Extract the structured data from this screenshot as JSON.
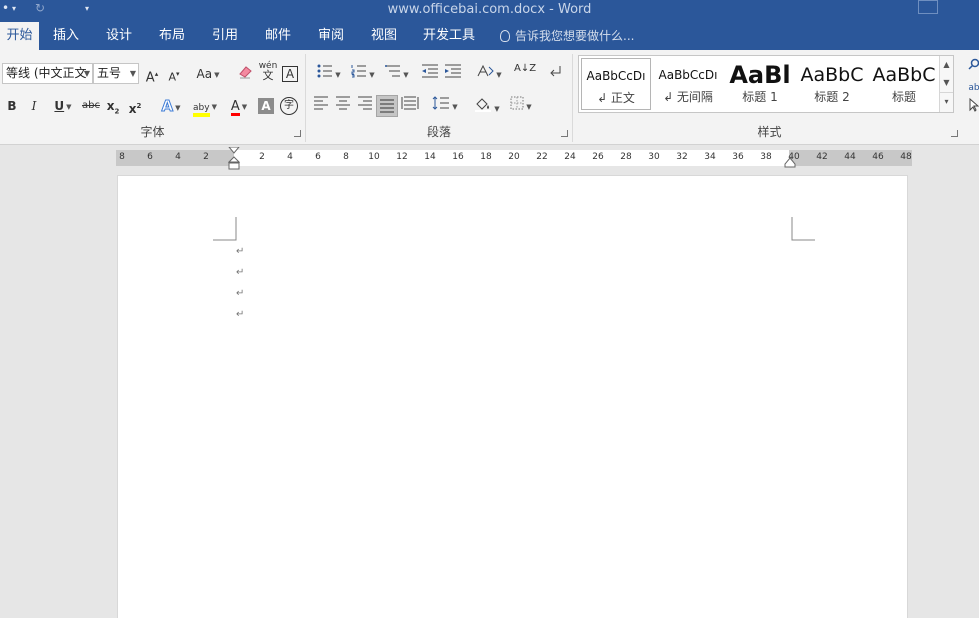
{
  "window": {
    "title": "www.officebai.com.docx - Word",
    "qat": [
      "•",
      "▾",
      "↻",
      "▾"
    ]
  },
  "tabs": [
    {
      "label": "开始",
      "active": true
    },
    {
      "label": "插入",
      "active": false
    },
    {
      "label": "设计",
      "active": false
    },
    {
      "label": "布局",
      "active": false
    },
    {
      "label": "引用",
      "active": false
    },
    {
      "label": "邮件",
      "active": false
    },
    {
      "label": "审阅",
      "active": false
    },
    {
      "label": "视图",
      "active": false
    },
    {
      "label": "开发工具",
      "active": false
    }
  ],
  "tell_me": "告诉我您想要做什么...",
  "font_group": {
    "label": "字体",
    "font_name": "等线 (中文正文",
    "font_size": "五号",
    "grow": "A",
    "shrink": "A",
    "change_case": "Aa",
    "phonetic_top": "wén",
    "phonetic_bottom": "文",
    "char_border": "A",
    "bold": "B",
    "italic": "I",
    "underline": "U",
    "strike": "abc",
    "subscript": "x",
    "superscript": "x",
    "text_effects": "A",
    "highlight": "aby",
    "font_color": "A",
    "char_shading": "A",
    "enclose": "字"
  },
  "paragraph_group": {
    "label": "段落",
    "sort": "A↓Z"
  },
  "styles_group": {
    "label": "样式",
    "items": [
      {
        "preview": "AaBbCcDı",
        "name": "↲ 正文"
      },
      {
        "preview": "AaBbCcDı",
        "name": "↲ 无间隔"
      },
      {
        "preview": "AaBl",
        "name": "标题 1"
      },
      {
        "preview": "AaBbC",
        "name": "标题 2"
      },
      {
        "preview": "AaBbC",
        "name": "标题"
      }
    ]
  },
  "ruler": {
    "left_ticks": [
      "8",
      "6",
      "4",
      "2"
    ],
    "ticks": [
      "2",
      "4",
      "6",
      "8",
      "10",
      "12",
      "14",
      "16",
      "18",
      "20",
      "22",
      "24",
      "26",
      "28",
      "30",
      "32",
      "34",
      "36",
      "38",
      "40",
      "42",
      "44",
      "46",
      "48"
    ]
  },
  "document": {
    "paragraph_marks": [
      "↵",
      "↵",
      "↵",
      "↵"
    ]
  },
  "colors": {
    "accent": "#2b579a",
    "highlight": "#ffff00",
    "font_color": "#ff0000"
  }
}
